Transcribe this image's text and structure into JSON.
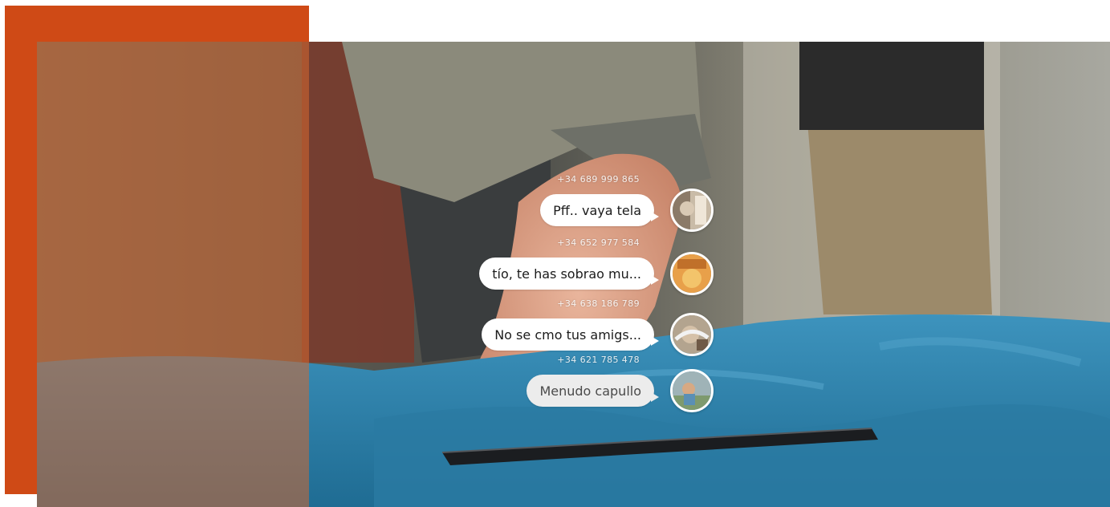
{
  "colors": {
    "accent": "#cf4a16",
    "bubble": "#ffffff",
    "bubble_dim": "#ececec",
    "phone_text": "#ffffff",
    "blanket": "#2f7fa6"
  },
  "messages": [
    {
      "phone": "+34 689 999 865",
      "text": "Pff.. vaya tela",
      "avatar": "avatar-photo-1",
      "style": "normal"
    },
    {
      "phone": "+34 652 977 584",
      "text": "tío, te has sobrao mu...",
      "avatar": "avatar-photo-2",
      "style": "normal"
    },
    {
      "phone": "+34 638 186 789",
      "text": "No se cmo tus amigs...",
      "avatar": "avatar-photo-3",
      "style": "normal"
    },
    {
      "phone": "+34 621 785 478",
      "text": "Menudo capullo",
      "avatar": "avatar-photo-4",
      "style": "dim"
    }
  ]
}
